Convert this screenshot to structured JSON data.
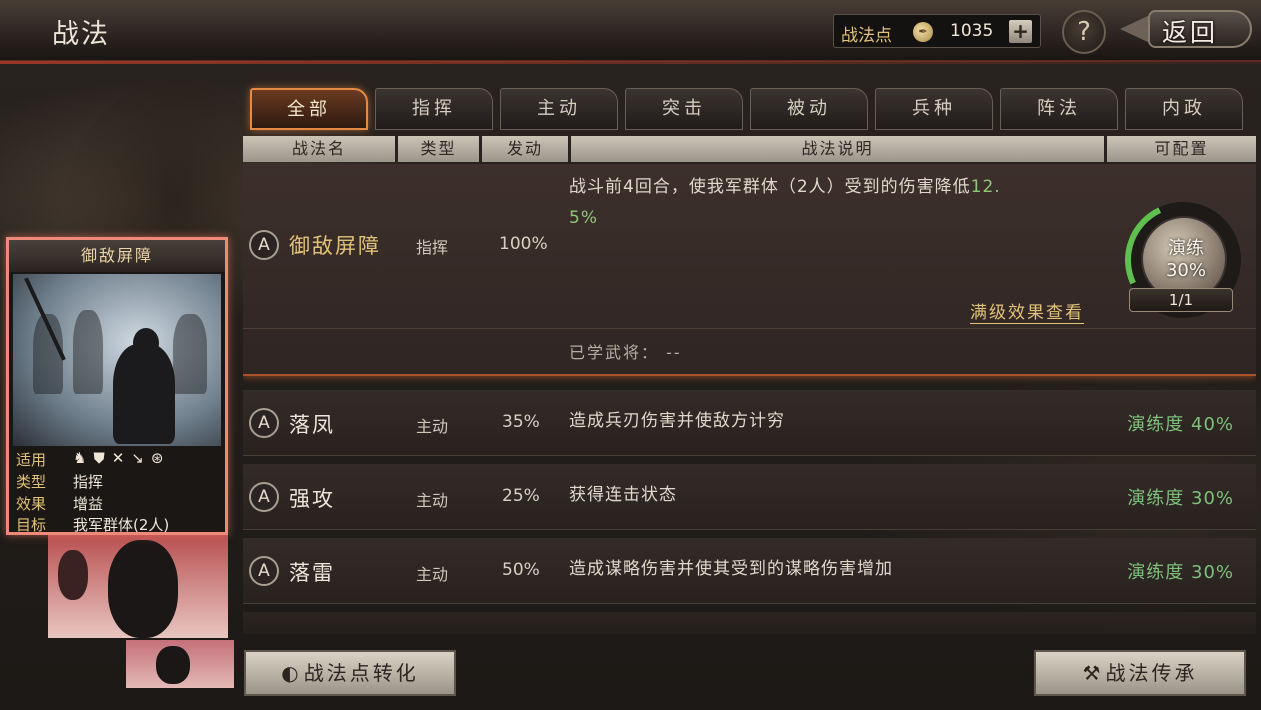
{
  "header": {
    "title": "战法",
    "points_label": "战法点",
    "points_value": "1035",
    "plus": "+",
    "help": "?",
    "back_label": "返回"
  },
  "tabs": [
    {
      "label": "全部",
      "active": true
    },
    {
      "label": "指挥",
      "active": false
    },
    {
      "label": "主动",
      "active": false
    },
    {
      "label": "突击",
      "active": false
    },
    {
      "label": "被动",
      "active": false
    },
    {
      "label": "兵种",
      "active": false
    },
    {
      "label": "阵法",
      "active": false
    },
    {
      "label": "内政",
      "active": false
    }
  ],
  "columns": {
    "name": "战法名",
    "type": "类型",
    "rate": "发动",
    "desc": "战法说明",
    "config": "可配置"
  },
  "expanded": {
    "grade": "A",
    "name": "御敌屏障",
    "type": "指挥",
    "rate": "100%",
    "desc_main": "战斗前4回合，使我军群体（2人）受到的伤害降低",
    "desc_value_a": "12.",
    "desc_value_b": "5%",
    "full_effect": "满级效果查看",
    "train_label": "演练",
    "train_value": "30%",
    "train_progress": 0.3,
    "train_count": "1/1",
    "learned": "已学武将：  --"
  },
  "rows": [
    {
      "grade": "A",
      "name": "落凤",
      "type": "主动",
      "rate": "35%",
      "desc": "造成兵刃伤害并使敌方计穷",
      "train": "演练度 40%"
    },
    {
      "grade": "A",
      "name": "强攻",
      "type": "主动",
      "rate": "25%",
      "desc": "获得连击状态",
      "train": "演练度 30%"
    },
    {
      "grade": "A",
      "name": "落雷",
      "type": "主动",
      "rate": "50%",
      "desc": "造成谋略伤害并使其受到的谋略伤害增加",
      "train": "演练度 30%"
    }
  ],
  "card": {
    "title": "御敌屏障",
    "apply_key": "适用",
    "type_key": "类型",
    "type_val": "指挥",
    "effect_key": "效果",
    "effect_val": "增益",
    "target_key": "目标",
    "target_val": "我军群体(2人)",
    "unit_icons": [
      "horse-icon",
      "shield-icon",
      "crossbow-icon",
      "spear-icon",
      "wheel-icon"
    ]
  },
  "bottom": {
    "convert": "战法点转化",
    "inherit": "战法传承"
  },
  "colors": {
    "accent_orange": "#e48a45",
    "train_green": "#7fc07a",
    "gold": "#e2c27a",
    "card_border": "#ef8a7a"
  }
}
